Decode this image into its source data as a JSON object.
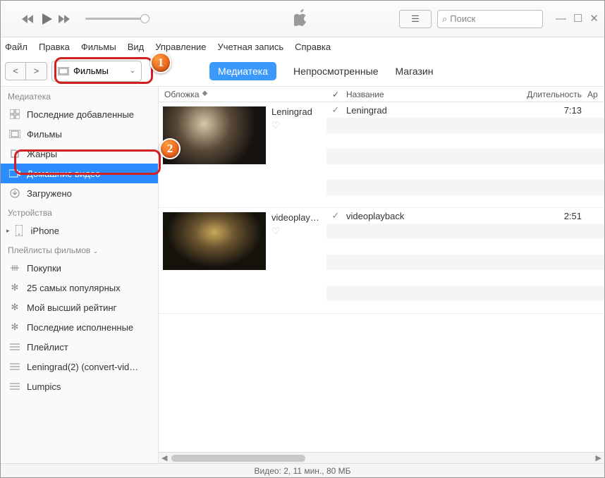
{
  "search": {
    "placeholder": "Поиск"
  },
  "menubar": [
    "Файл",
    "Правка",
    "Фильмы",
    "Вид",
    "Управление",
    "Учетная запись",
    "Справка"
  ],
  "dropdown": {
    "label": "Фильмы"
  },
  "tabs": [
    {
      "label": "Медиатека",
      "active": true
    },
    {
      "label": "Непросмотренные",
      "active": false
    },
    {
      "label": "Магазин",
      "active": false
    }
  ],
  "sidebar": {
    "sections": {
      "library": "Медиатека",
      "devices": "Устройства",
      "playlists": "Плейлисты фильмов"
    },
    "library": [
      {
        "label": "Последние добавленные",
        "icon": "grid"
      },
      {
        "label": "Фильмы",
        "icon": "film"
      },
      {
        "label": "Жанры",
        "icon": "genres"
      },
      {
        "label": "Домашние видео",
        "icon": "home-video",
        "selected": true
      },
      {
        "label": "Загружено",
        "icon": "download"
      }
    ],
    "devices": [
      {
        "label": "iPhone",
        "icon": "phone",
        "expandable": true
      }
    ],
    "playlists": [
      {
        "label": "Покупки",
        "icon": "purchases"
      },
      {
        "label": "25 самых популярных",
        "icon": "gear"
      },
      {
        "label": "Мой высший рейтинг",
        "icon": "gear"
      },
      {
        "label": "Последние исполненные",
        "icon": "gear"
      },
      {
        "label": "Плейлист",
        "icon": "playlist"
      },
      {
        "label": "Leningrad(2)  (convert-vid…",
        "icon": "playlist"
      },
      {
        "label": "Lumpics",
        "icon": "playlist"
      }
    ]
  },
  "columns": {
    "cover": "Обложка",
    "name": "Название",
    "duration": "Длительность",
    "artist": "Ар"
  },
  "items": [
    {
      "title": "Leningrad",
      "track": "Leningrad",
      "duration": "7:13",
      "thumb": "t1"
    },
    {
      "title": "videoplay…",
      "track": "videoplayback",
      "duration": "2:51",
      "thumb": "t2"
    }
  ],
  "status": "Видео: 2, 11 мин., 80 МБ",
  "callouts": {
    "one": "1",
    "two": "2"
  }
}
